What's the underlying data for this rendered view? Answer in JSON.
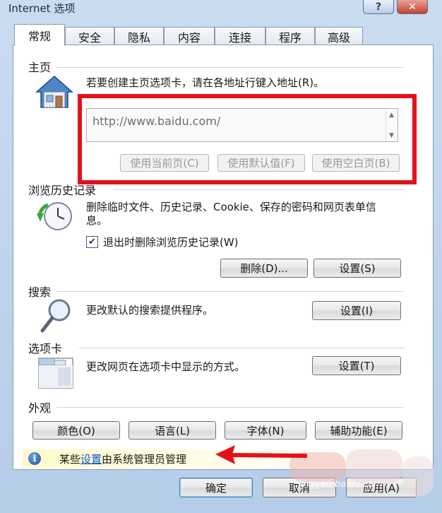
{
  "window": {
    "title": "Internet 选项",
    "help": "?",
    "close": "✕"
  },
  "tabs": [
    "常规",
    "安全",
    "隐私",
    "内容",
    "连接",
    "程序",
    "高级"
  ],
  "homepage": {
    "title": "主页",
    "instruction": "若要创建主页选项卡，请在各地址行键入地址(R)。",
    "url_value": "http://www.baidu.com/",
    "buttons": {
      "current": "使用当前页(C)",
      "default": "使用默认值(F)",
      "blank": "使用空白页(B)"
    }
  },
  "history": {
    "title": "浏览历史记录",
    "description": "删除临时文件、历史记录、Cookie、保存的密码和网页表单信息。",
    "checkbox_label": "退出时删除浏览历史记录(W)",
    "checkbox_checked": true,
    "delete_label": "删除(D)...",
    "settings_label": "设置(S)"
  },
  "search": {
    "title": "搜索",
    "description": "更改默认的搜索提供程序。",
    "settings_label": "设置(I)"
  },
  "tabsgroup": {
    "title": "选项卡",
    "description": "更改网页在选项卡中显示的方式。",
    "settings_label": "设置(T)"
  },
  "appearance": {
    "title": "外观",
    "colors": "颜色(O)",
    "languages": "语言(L)",
    "fonts": "字体(N)",
    "accessibility": "辅助功能(E)"
  },
  "info": {
    "prefix": "某些",
    "link": "设置",
    "suffix": "由系统管理员管理"
  },
  "footer": {
    "ok": "确定",
    "cancel": "取消",
    "apply": "应用(A)"
  },
  "watermark": "jingyan.baidu.com",
  "colors": {
    "highlight": "#e4111b",
    "link": "#0b57c8"
  },
  "icons": {
    "home": "house-icon",
    "history": "clock-refresh-icon",
    "search": "magnifier-icon",
    "tabs": "tab-window-icon",
    "info": "info-icon"
  }
}
